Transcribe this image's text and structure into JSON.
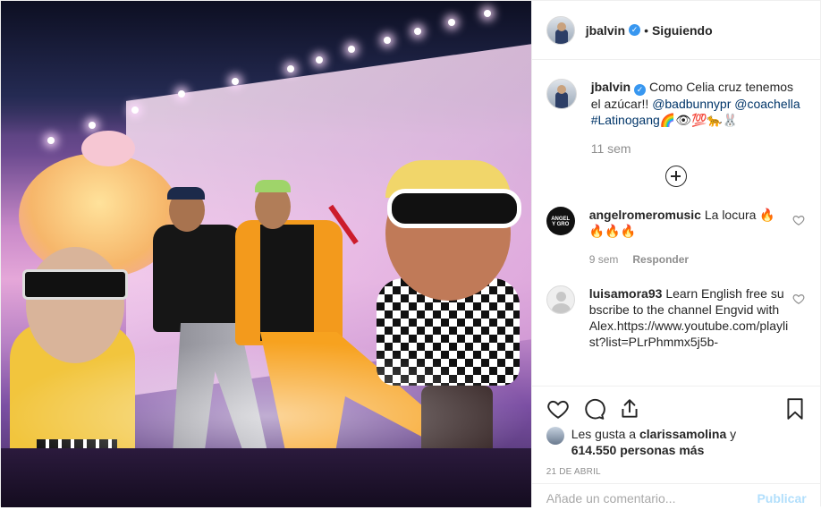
{
  "header": {
    "username": "jbalvin",
    "verified_mark": "✓",
    "separator": "•",
    "follow_status": "Siguiendo"
  },
  "caption": {
    "username": "jbalvin",
    "text_before": "Como Celia cruz tenemos el azúcar!! ",
    "mention1": "@badbunnypr",
    "mention2": "@coachella",
    "hashtag": "#Latinogang",
    "emojis": "🌈👁💯🐆🐰",
    "time": "11 sem"
  },
  "comments": [
    {
      "username": "angelromeromusic",
      "text": "La locura 🔥🔥🔥🔥",
      "time": "9 sem",
      "reply_label": "Responder",
      "avatar_text": "ANGEL Y GRO"
    },
    {
      "username": "luisamora93",
      "text": "Learn English free subscribe to the channel Engvid with Alex.https://www.youtube.com/playlist?list=PLrPhmmx5j5b-"
    }
  ],
  "likes": {
    "prefix": "Les gusta a ",
    "user": "clarissamolina",
    "middle": " y",
    "count_text": "614.550 personas más"
  },
  "date": "21 DE ABRIL",
  "add_comment": {
    "placeholder": "Añade un comentario...",
    "publish_label": "Publicar"
  },
  "icons": {
    "like": "heart-icon",
    "comment": "comment-icon",
    "share": "share-icon",
    "save": "bookmark-icon",
    "load_more": "plus-circle-icon"
  },
  "colors": {
    "verified": "#3897f0",
    "link": "#003569",
    "meta": "#8e8e8e",
    "text": "#262626"
  }
}
